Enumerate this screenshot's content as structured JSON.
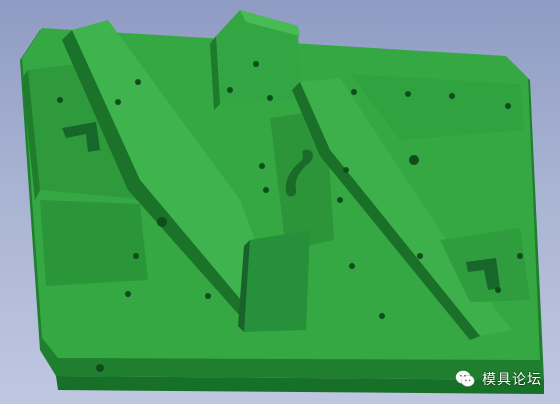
{
  "viewport": {
    "background_top": "#8f9bc3",
    "background_bottom": "#bfc7e0",
    "model_color": "#2f9e3c"
  },
  "watermark": {
    "icon": "wechat-logo-icon",
    "text": "模具论坛"
  }
}
